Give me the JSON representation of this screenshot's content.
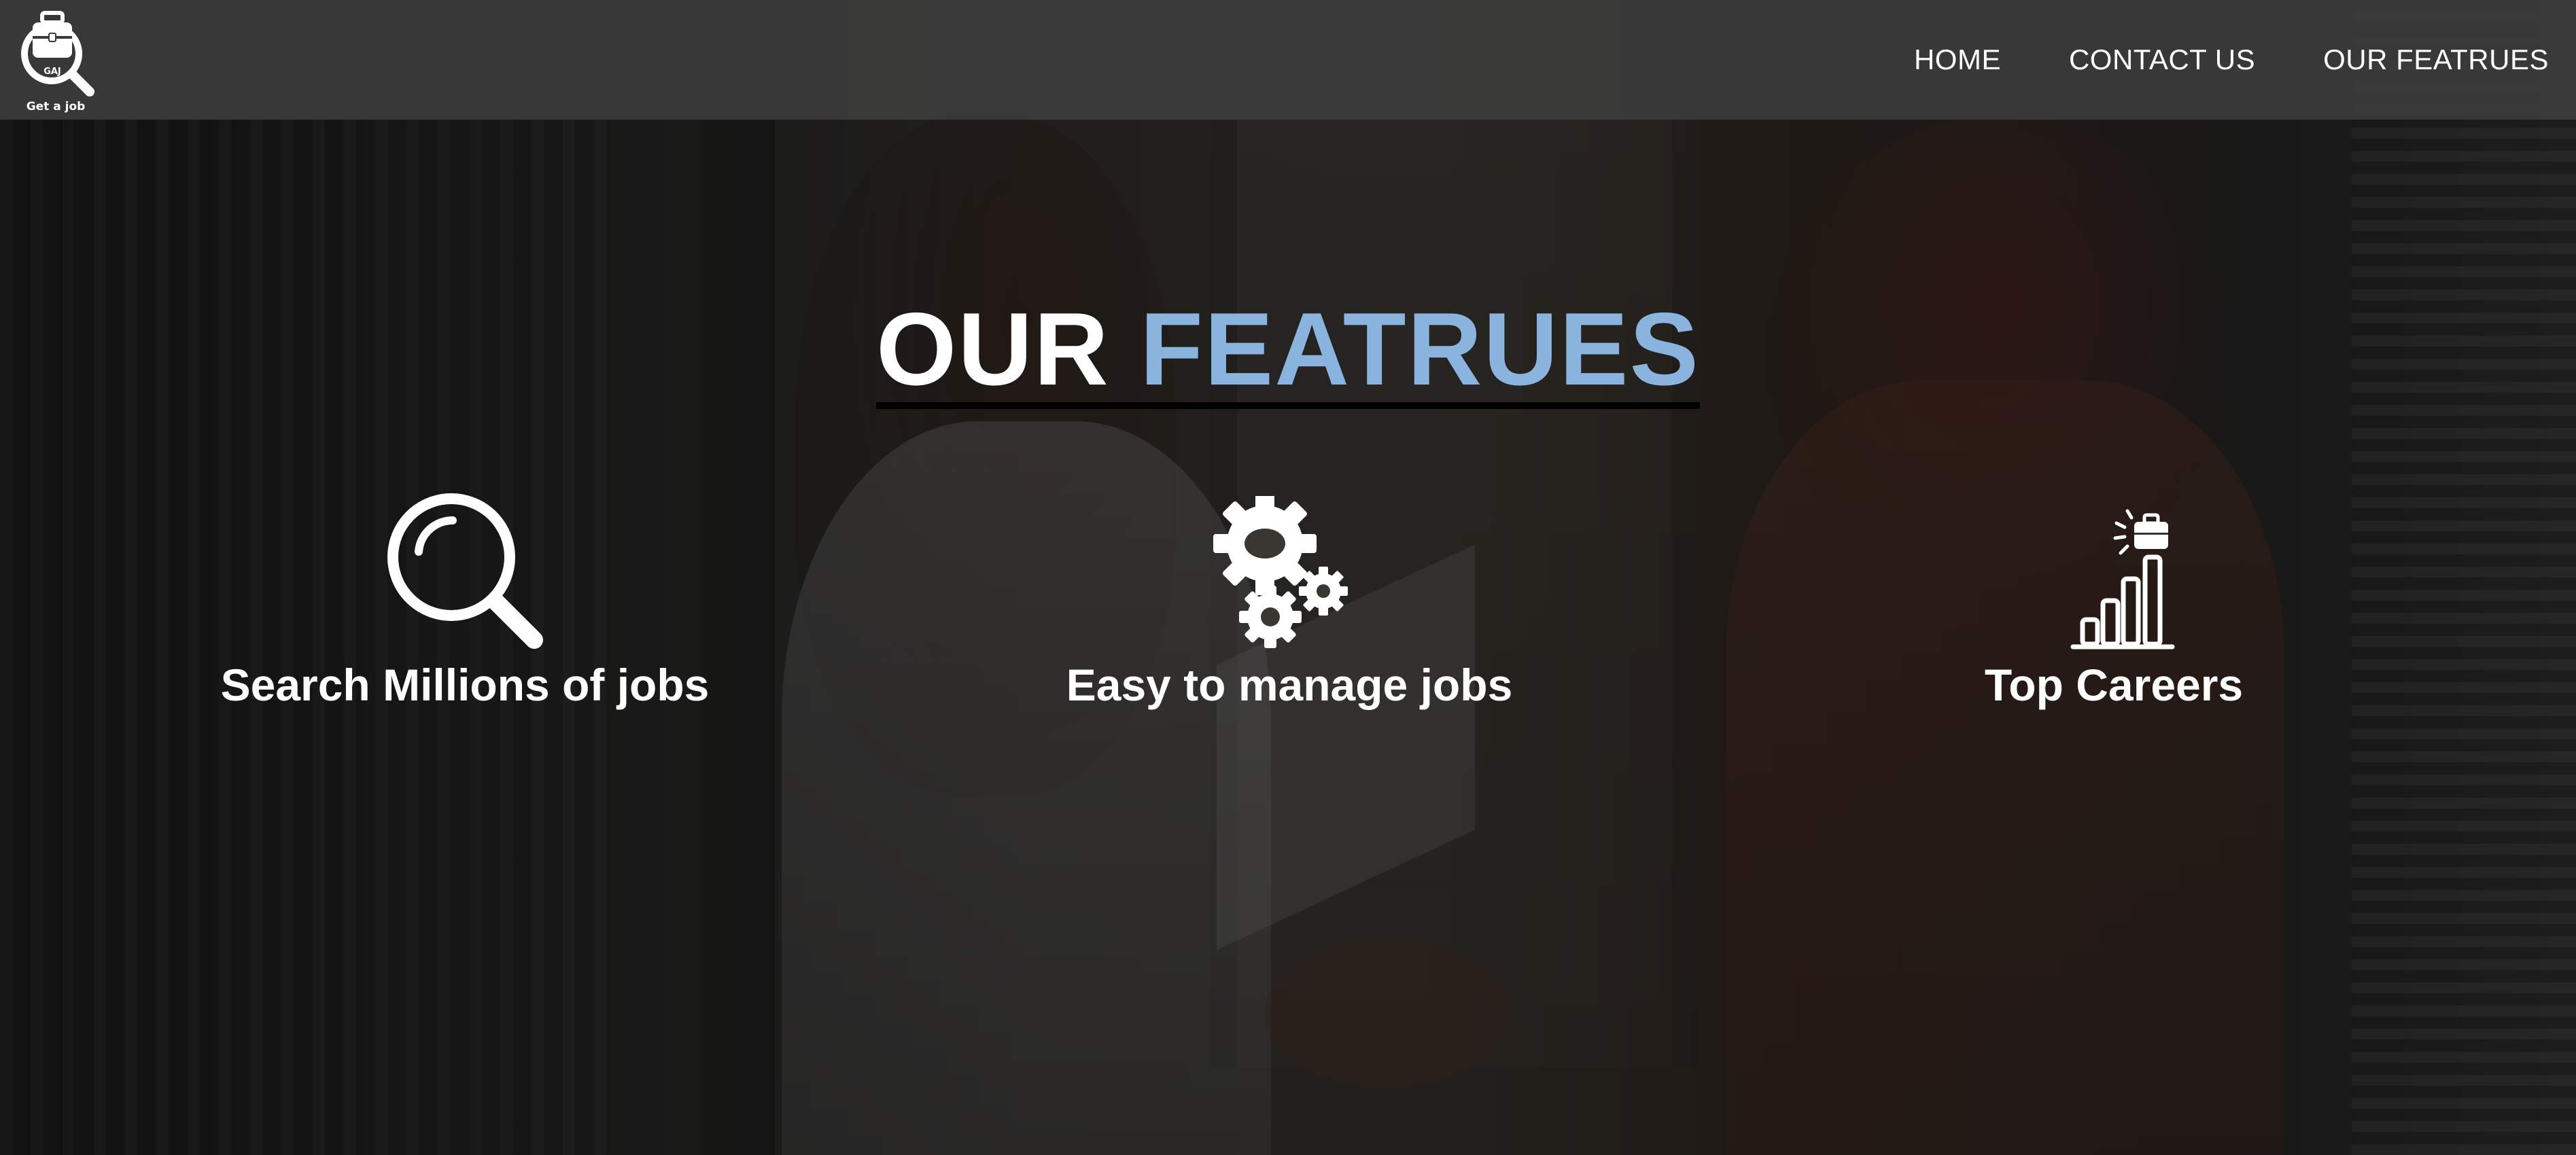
{
  "header": {
    "logo": {
      "badge_text": "GAJ",
      "caption": "Get a job",
      "icon": "briefcase-magnifier-icon"
    },
    "nav": [
      {
        "label": "HOME"
      },
      {
        "label": "CONTACT US"
      },
      {
        "label": "OUR FEATRUES"
      }
    ]
  },
  "hero": {
    "title_part1": "OUR",
    "title_part2": "FEATRUES",
    "title_accent_color": "#8ab3dd"
  },
  "features": [
    {
      "label": "Search Millions of jobs",
      "icon": "magnifying-glass-icon"
    },
    {
      "label": "Easy to manage jobs",
      "icon": "gears-icon"
    },
    {
      "label": "Top Careers",
      "icon": "career-growth-chart-icon"
    }
  ]
}
